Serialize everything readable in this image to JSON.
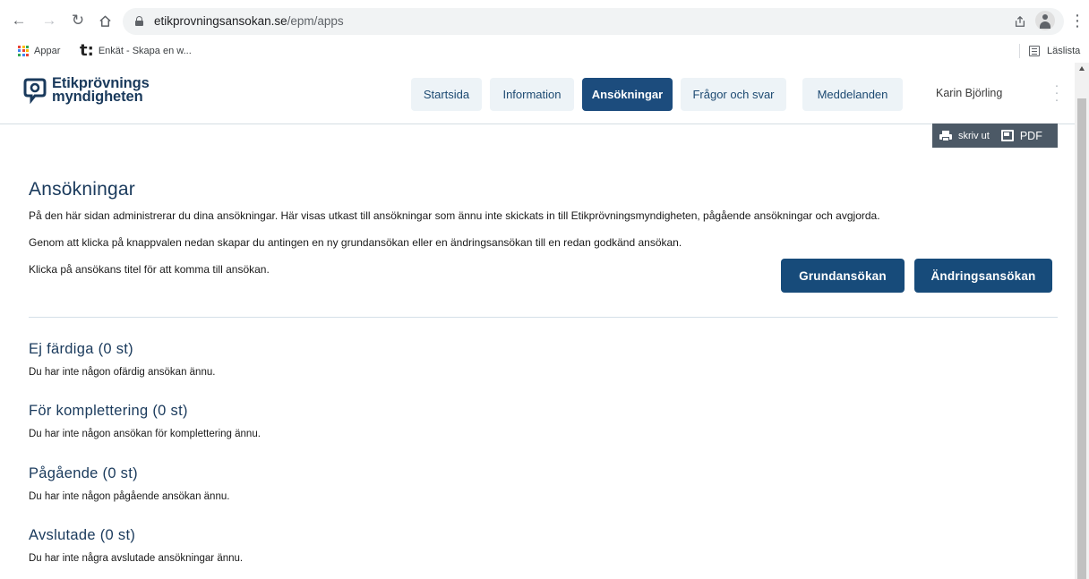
{
  "browser": {
    "url_host": "etikprovningsansokan.se",
    "url_path": "/epm/apps",
    "bookmarks": [
      {
        "label": "Appar"
      },
      {
        "label": "Enkät - Skapa en w..."
      }
    ],
    "reading_list_label": "Läslista"
  },
  "header": {
    "logo_line1": "Etikprövnings",
    "logo_line2": "myndigheten",
    "nav": [
      {
        "label": "Startsida"
      },
      {
        "label": "Information"
      },
      {
        "label": "Ansökningar"
      },
      {
        "label": "Frågor och svar"
      },
      {
        "label": "Meddelanden"
      }
    ],
    "active_nav": "Ansökningar",
    "user_name": "Karin Björling"
  },
  "toolbar": {
    "print_label": "skriv ut",
    "pdf_label": "PDF"
  },
  "main": {
    "title": "Ansökningar",
    "intro": [
      "På den här sidan administrerar du dina ansökningar. Här visas utkast till ansökningar som ännu inte skickats in till Etikprövningsmyndigheten, pågående ansökningar och avgjorda.",
      "Genom att klicka på knappvalen nedan skapar du antingen en ny grundansökan eller en ändringsansökan till en redan godkänd ansökan.",
      "Klicka på ansökans titel för att komma till ansökan."
    ],
    "buttons": {
      "basic": "Grundansökan",
      "change": "Ändringsansökan"
    },
    "sections": [
      {
        "title": "Ej färdiga (0 st)",
        "text": "Du har inte någon ofärdig ansökan ännu."
      },
      {
        "title": "För komplettering (0 st)",
        "text": "Du har inte någon ansökan för komplettering ännu."
      },
      {
        "title": "Pågående (0 st)",
        "text": "Du har inte någon pågående ansökan ännu."
      },
      {
        "title": "Avslutade (0 st)",
        "text": "Du har inte några avslutade ansökningar ännu."
      }
    ]
  },
  "colors": {
    "brand": "#1a3a5c",
    "primary_button": "#174b7a",
    "nav_bg": "#edf3f7",
    "print_bar": "#4c5966"
  }
}
